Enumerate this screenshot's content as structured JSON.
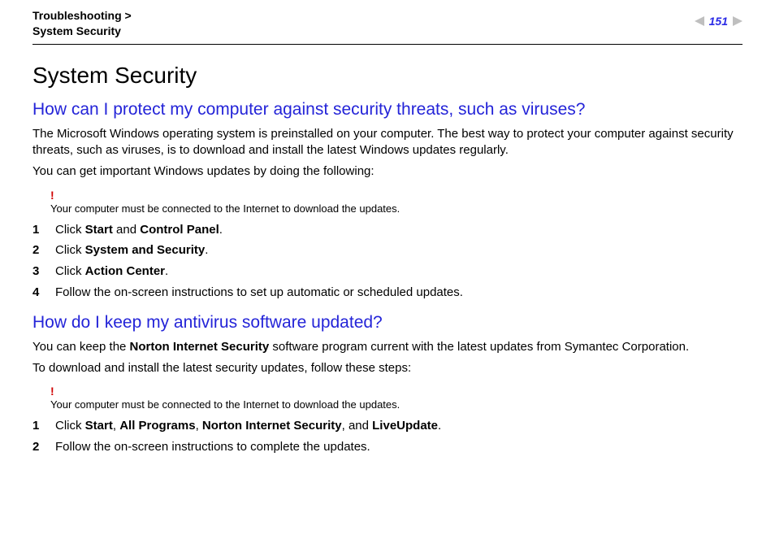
{
  "header": {
    "breadcrumb_top": "Troubleshooting >",
    "breadcrumb_bottom": "System Security",
    "page_number": "151"
  },
  "title": "System Security",
  "section1": {
    "heading": "How can I protect my computer against security threats, such as viruses?",
    "p1": "The Microsoft Windows operating system is preinstalled on your computer. The best way to protect your computer against security threats, such as viruses, is to download and install the latest Windows updates regularly.",
    "p2": "You can get important Windows updates by doing the following:",
    "note_mark": "!",
    "note": "Your computer must be connected to the Internet to download the updates.",
    "steps": [
      {
        "pre": "Click ",
        "b1": "Start",
        "mid": " and ",
        "b2": "Control Panel",
        "post": "."
      },
      {
        "pre": "Click ",
        "b1": "System and Security",
        "post": "."
      },
      {
        "pre": "Click ",
        "b1": "Action Center",
        "post": "."
      },
      {
        "pre": "Follow the on-screen instructions to set up automatic or scheduled updates."
      }
    ]
  },
  "section2": {
    "heading": "How do I keep my antivirus software updated?",
    "p1_pre": "You can keep the ",
    "p1_b": "Norton Internet Security",
    "p1_post": " software program current with the latest updates from Symantec Corporation.",
    "p2": "To download and install the latest security updates, follow these steps:",
    "note_mark": "!",
    "note": "Your computer must be connected to the Internet to download the updates.",
    "steps": [
      {
        "pre": "Click ",
        "b1": "Start",
        "c1": ", ",
        "b2": "All Programs",
        "c2": ", ",
        "b3": "Norton Internet Security",
        "c3": ", and ",
        "b4": "LiveUpdate",
        "post": "."
      },
      {
        "pre": "Follow the on-screen instructions to complete the updates."
      }
    ]
  }
}
